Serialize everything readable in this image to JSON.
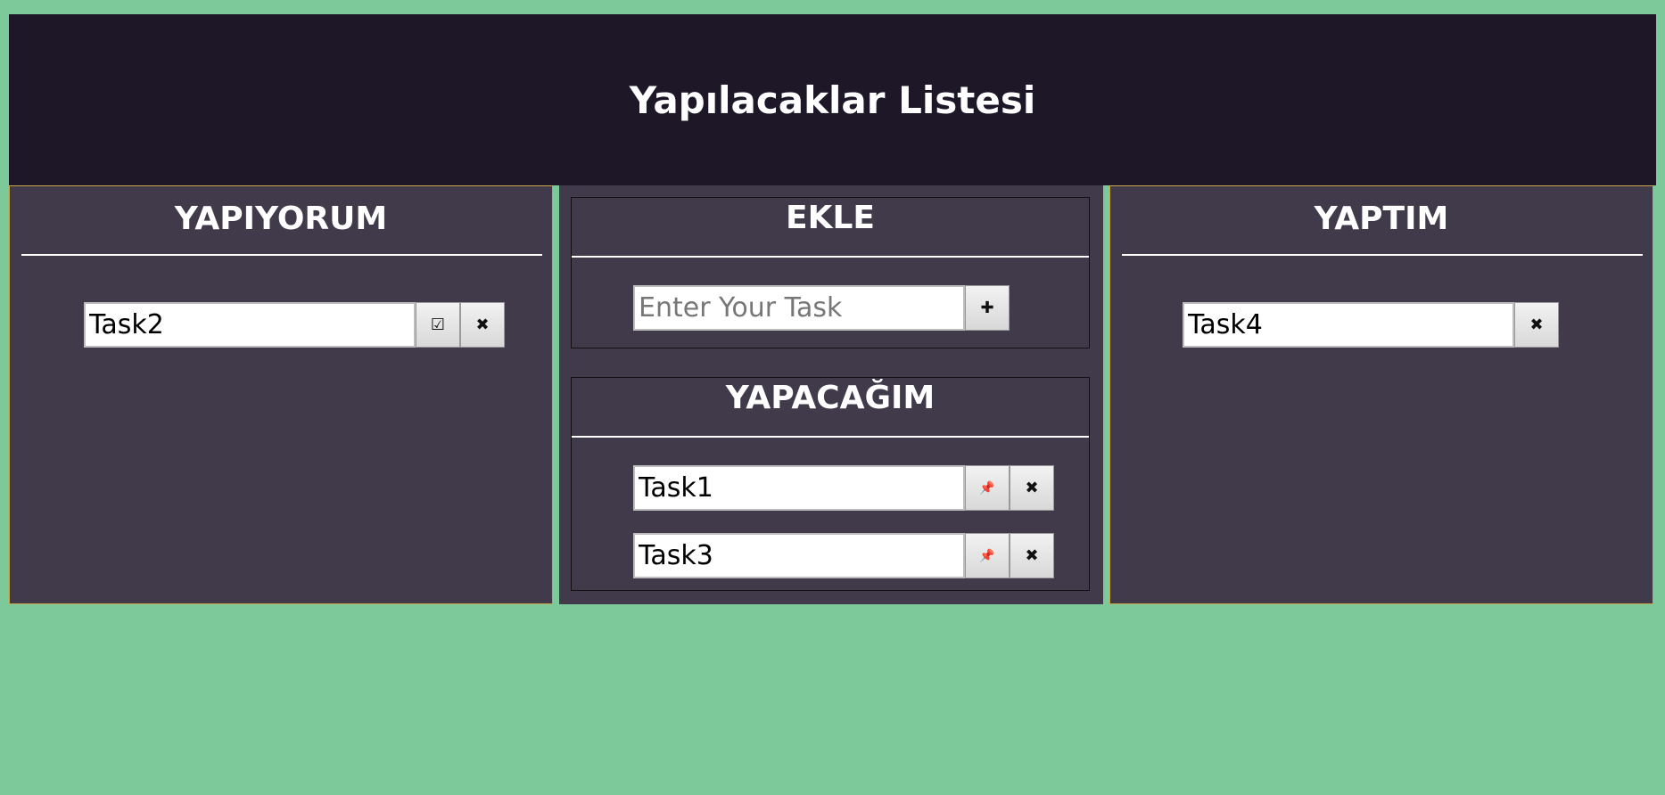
{
  "header": {
    "title": "Yapılacaklar Listesi"
  },
  "doing": {
    "title": "YAPIYORUM",
    "tasks": [
      {
        "value": "Task2",
        "done_icon": "☑",
        "delete_icon": "✖"
      }
    ]
  },
  "add": {
    "title": "EKLE",
    "placeholder": "Enter Your Task",
    "add_icon": "✚"
  },
  "todo": {
    "title": "YAPACAĞIM",
    "tasks": [
      {
        "value": "Task1",
        "pin_icon": "📌",
        "delete_icon": "✖"
      },
      {
        "value": "Task3",
        "pin_icon": "📌",
        "delete_icon": "✖"
      }
    ]
  },
  "done": {
    "title": "YAPTIM",
    "tasks": [
      {
        "value": "Task4",
        "delete_icon": "✖"
      }
    ]
  },
  "colors": {
    "background": "#7ec99a",
    "header": "#1d1728",
    "panel": "#413a4b"
  }
}
